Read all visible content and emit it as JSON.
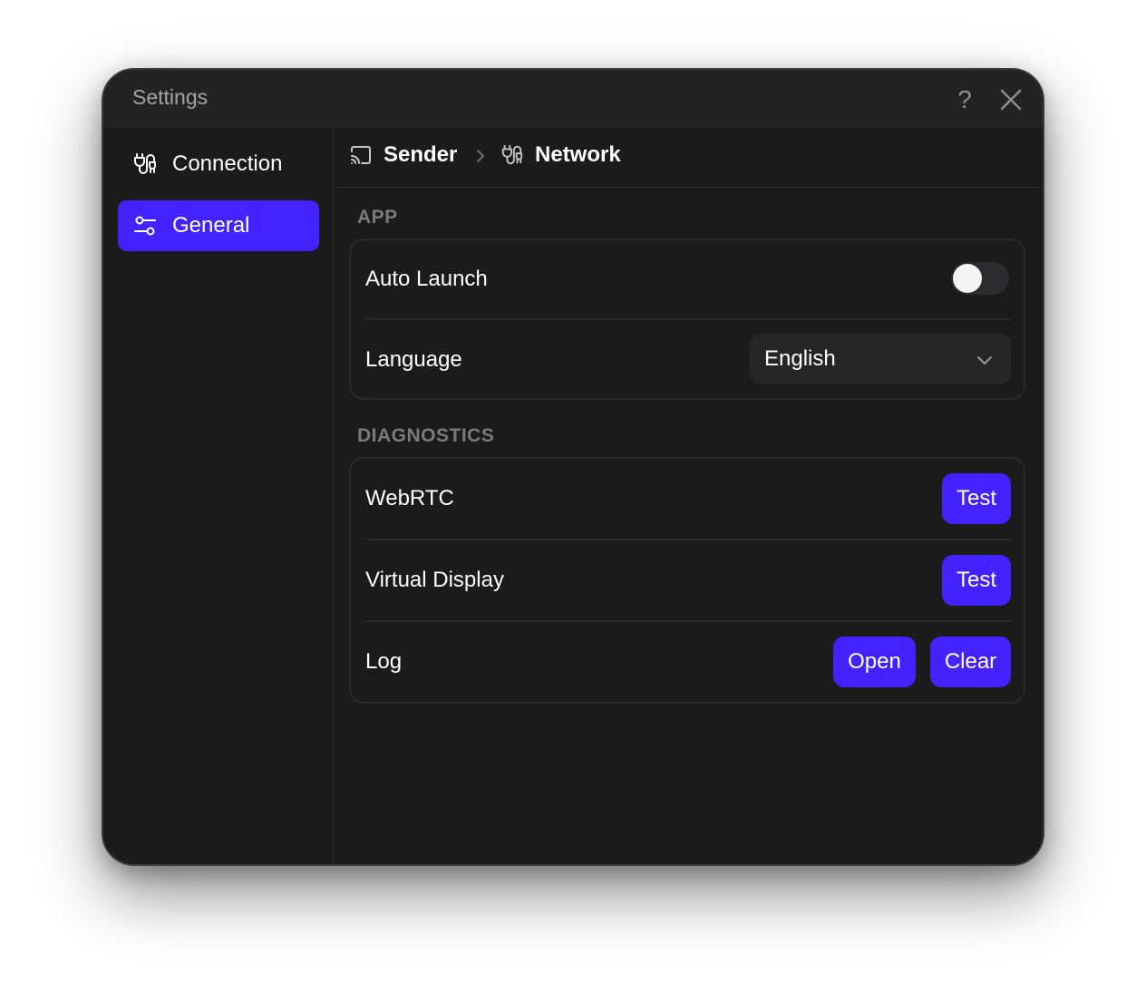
{
  "window": {
    "title": "Settings"
  },
  "titlebar": {
    "help_glyph": "?"
  },
  "sidebar": {
    "items": [
      {
        "label": "Connection",
        "icon": "plug-connection-icon",
        "active": false
      },
      {
        "label": "General",
        "icon": "sliders-icon",
        "active": true
      }
    ]
  },
  "breadcrumb": {
    "items": [
      {
        "label": "Sender",
        "icon": "cast-icon"
      },
      {
        "label": "Network",
        "icon": "plug-connection-icon"
      }
    ]
  },
  "sections": {
    "app": {
      "title": "APP",
      "auto_launch": {
        "label": "Auto Launch",
        "enabled": false
      },
      "language": {
        "label": "Language",
        "value": "English"
      }
    },
    "diagnostics": {
      "title": "DIAGNOSTICS",
      "webrtc": {
        "label": "WebRTC",
        "button": "Test"
      },
      "virtual_display": {
        "label": "Virtual Display",
        "button": "Test"
      },
      "log": {
        "label": "Log",
        "open_button": "Open",
        "clear_button": "Clear"
      }
    }
  },
  "colors": {
    "accent": "#4422ff",
    "window_bg": "#1b1b1c",
    "titlebar_bg": "#232324",
    "section_title": "#7b7b7e"
  }
}
